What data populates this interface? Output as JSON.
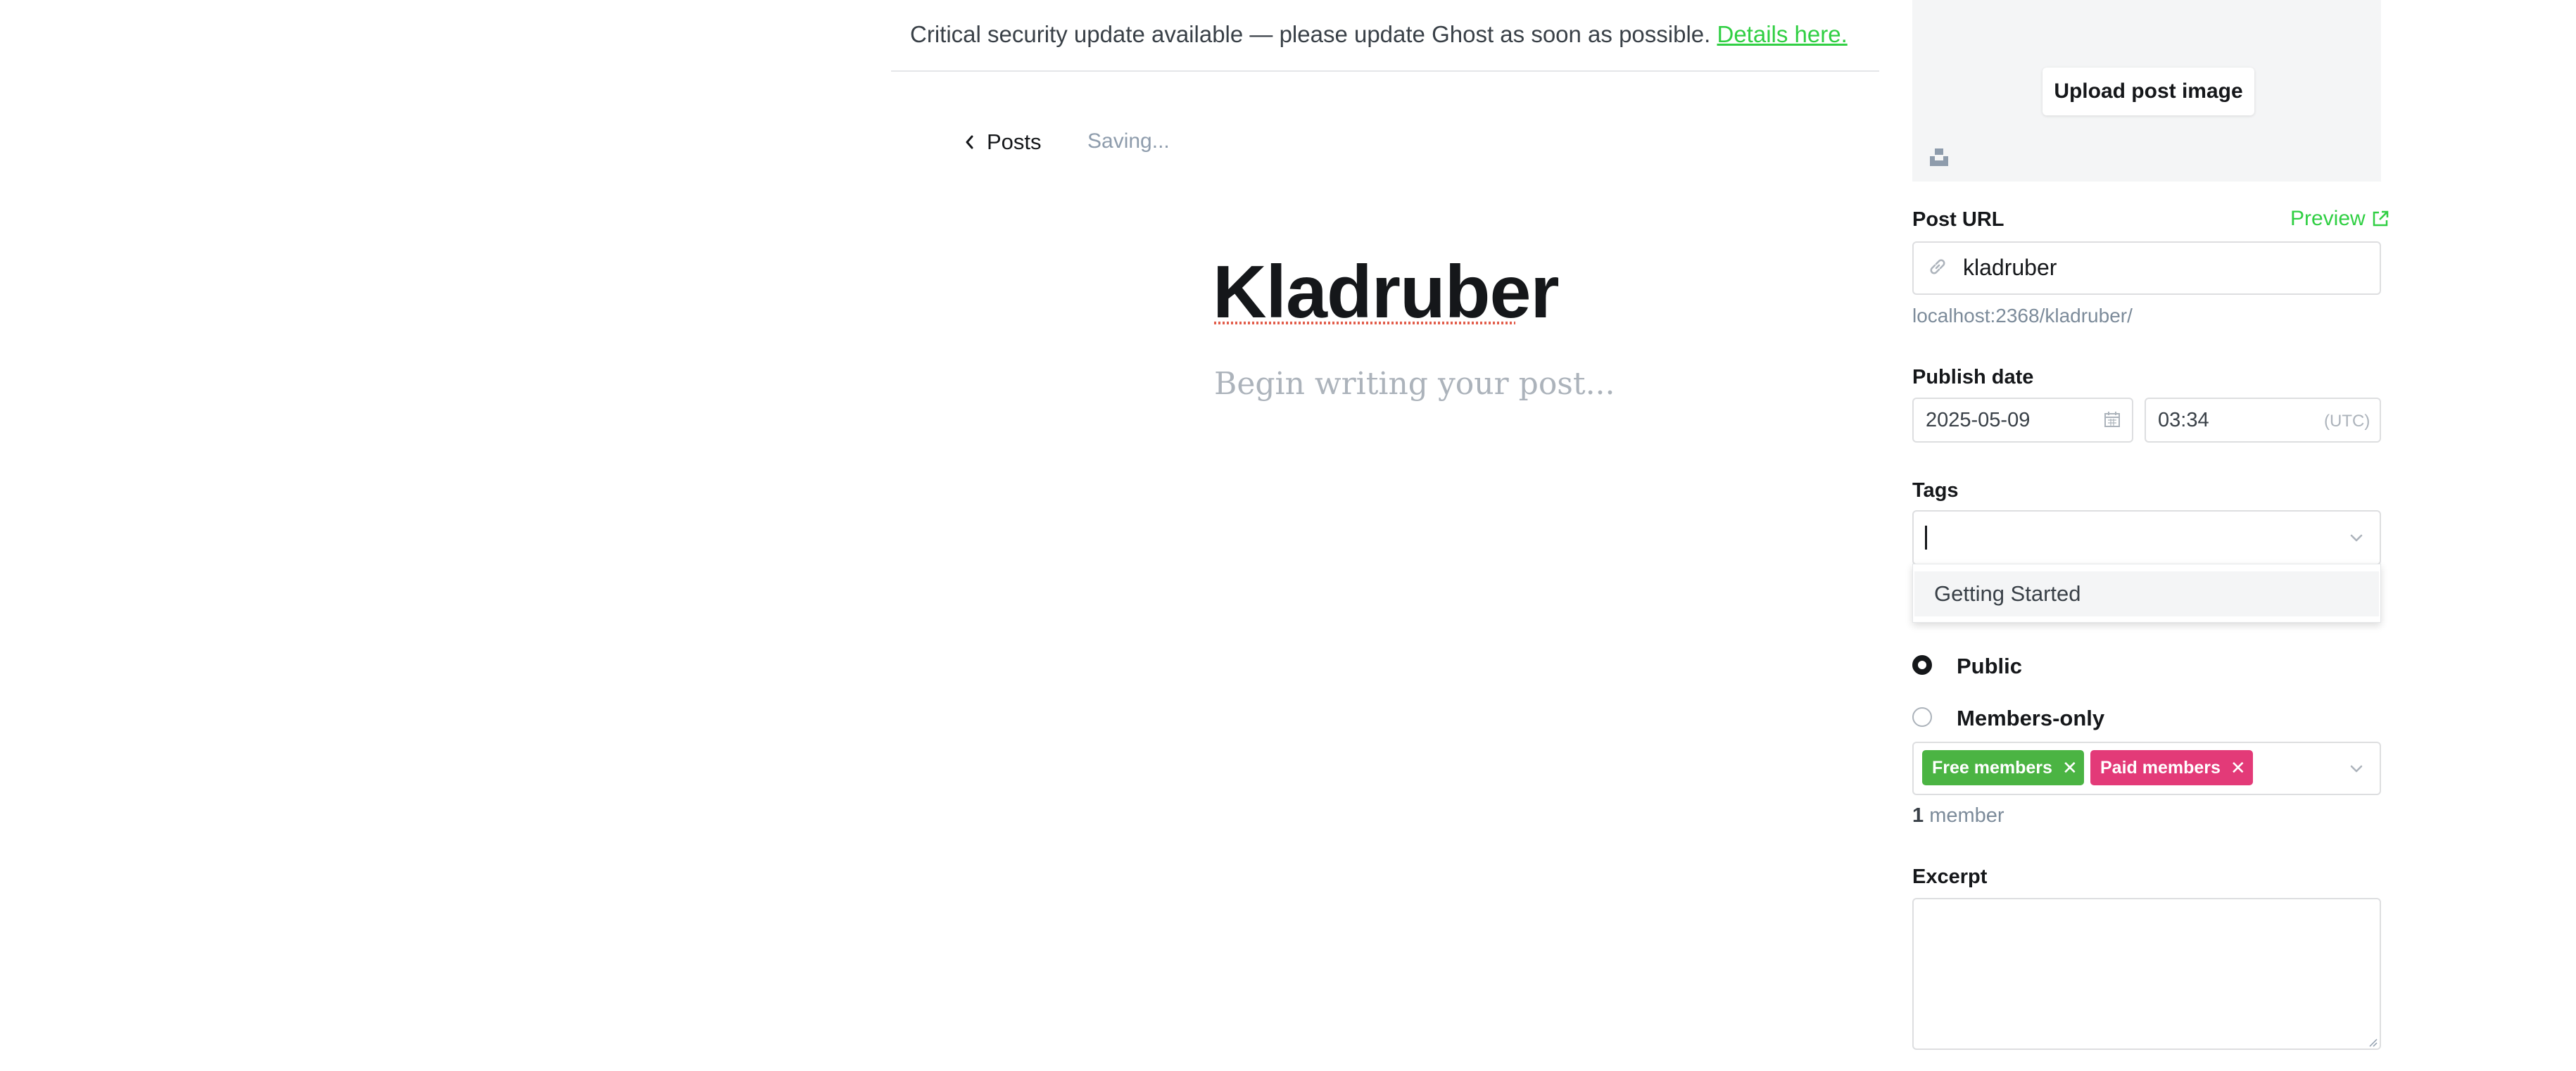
{
  "banner": {
    "message": "Critical security update available — please update Ghost as soon as possible.",
    "link_label": "Details here."
  },
  "editor_nav": {
    "back_label": "Posts",
    "status": "Saving..."
  },
  "editor": {
    "title": "Kladruber",
    "body_placeholder": "Begin writing your post..."
  },
  "sidebar": {
    "upload_label": "Upload post image",
    "post_url": {
      "label": "Post URL",
      "preview_label": "Preview",
      "value": "kladruber",
      "hint": "localhost:2368/kladruber/"
    },
    "publish_date": {
      "label": "Publish date",
      "date": "2025-05-09",
      "time": "03:34",
      "timezone": "(UTC)"
    },
    "tags": {
      "label": "Tags",
      "value": "",
      "options": [
        "Getting Started"
      ]
    },
    "access": {
      "options": [
        {
          "label": "Public",
          "selected": true
        },
        {
          "label": "Members-only",
          "selected": false
        }
      ],
      "segments": [
        {
          "label": "Free members",
          "color": "#4bb443"
        },
        {
          "label": "Paid members",
          "color": "#e33a78"
        }
      ],
      "member_count": "1",
      "member_label": "member"
    },
    "excerpt": {
      "label": "Excerpt",
      "value": ""
    }
  },
  "colors": {
    "accent_green": "#30cf43",
    "text_primary": "#15171a",
    "muted": "#7c8b9a"
  }
}
